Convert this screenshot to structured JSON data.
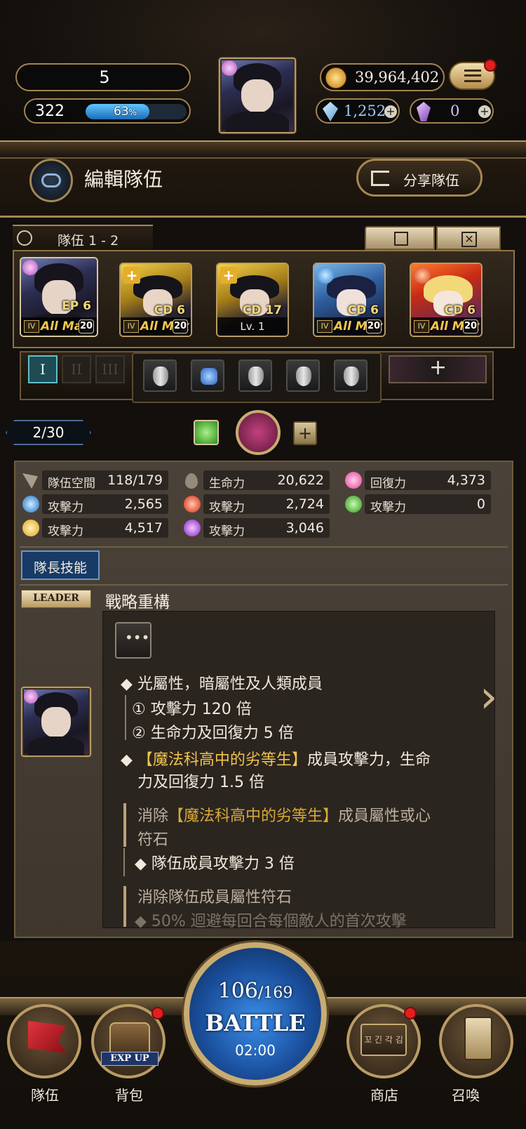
{
  "topbar": {
    "player_level": "5",
    "exp_value": "322",
    "exp_percent_label": "63",
    "exp_percent_unit": "%",
    "exp_fraction": 0.63,
    "coins": "39,964,402",
    "diamonds": "1,252",
    "soul_crystals": "0"
  },
  "header": {
    "title": "編輯隊伍",
    "share_label": "分享隊伍"
  },
  "team": {
    "name": "隊伍 1 - 2",
    "cards": [
      {
        "tag": "EP 6",
        "rank": "IV",
        "status": "All Max",
        "level": "20",
        "theme": "dark"
      },
      {
        "tag": "CD 6",
        "rank": "IV",
        "status": "All Max",
        "level": "20",
        "theme": "gold"
      },
      {
        "tag": "CD 17",
        "status": "Lv. 1",
        "theme": "gold"
      },
      {
        "tag": "CD 6",
        "rank": "IV",
        "status": "All Max",
        "level": "20",
        "theme": "blue"
      },
      {
        "tag": "CD 6",
        "rank": "IV",
        "status": "All Max",
        "level": "20",
        "theme": "red"
      }
    ],
    "tabs": [
      "I",
      "II",
      "III"
    ]
  },
  "page_indicator": "2/30",
  "stats": {
    "space_label": "隊伍空間",
    "space_value": "118/179",
    "hp_label": "生命力",
    "hp_value": "20,622",
    "heal_label": "回復力",
    "heal_value": "4,373",
    "water_label": "攻擊力",
    "water_value": "2,565",
    "fire_label": "攻擊力",
    "fire_value": "2,724",
    "wood_label": "攻擊力",
    "wood_value": "0",
    "light_label": "攻擊力",
    "light_value": "4,517",
    "dark_label": "攻擊力",
    "dark_value": "3,046"
  },
  "leader_section": {
    "tab_label": "隊長技能",
    "leader_badge": "LEADER",
    "skill_name": "戰略重構",
    "lines": {
      "l1": "◆ 光屬性，暗屬性及人類成員",
      "l2": "① 攻擊力 120 倍",
      "l3": "② 生命力及回復力 5 倍",
      "l4a": "◆ ",
      "l4b": "【魔法科高中的劣等生】",
      "l4c": "成員攻擊力，生命",
      "l5": "力及回復力 1.5 倍",
      "l6a": "消除",
      "l6b": "【魔法科高中的劣等生】",
      "l6c": "成員屬性或心",
      "l7": "符石",
      "l8": "◆ 隊伍成員攻擊力 3 倍",
      "l9": "消除隊伍成員屬性符石",
      "l10": "◆ 50% 迴避每回合每個敵人的首次攻擊"
    }
  },
  "battle": {
    "stamina_current": "106",
    "stamina_max": "/169",
    "label": "BATTLE",
    "timer": "02:00"
  },
  "nav": {
    "team": "隊伍",
    "bag": "背包",
    "bag_badge": "EXP UP",
    "shop": "商店",
    "shop_sign": "꼬 긴 각 김",
    "summon": "召喚"
  },
  "colors": {
    "gold_frame": "#b69a66",
    "accent_gold": "#f0c24a",
    "battle_blue": "#2f7ad6",
    "notif_red": "#e21f1f"
  }
}
